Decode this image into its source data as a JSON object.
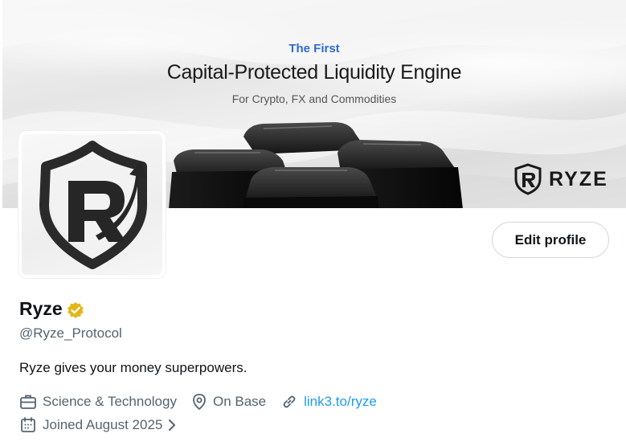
{
  "banner": {
    "eyebrow": "The First",
    "title": "Capital-Protected Liquidity Engine",
    "subtitle": "For Crypto, FX and Commodities",
    "brand_word": "RYZE"
  },
  "profile": {
    "name": "Ryze",
    "handle": "@Ryze_Protocol",
    "bio": "Ryze gives your money superpowers.",
    "edit_label": "Edit profile",
    "category": "Science & Technology",
    "location": "On Base",
    "link": "link3.to/ryze",
    "joined": "Joined August 2025"
  },
  "colors": {
    "accent_blue": "#2f6bcf",
    "link": "#1d9bf0",
    "verified_gold": "#e2b719",
    "muted_text": "#536471"
  }
}
